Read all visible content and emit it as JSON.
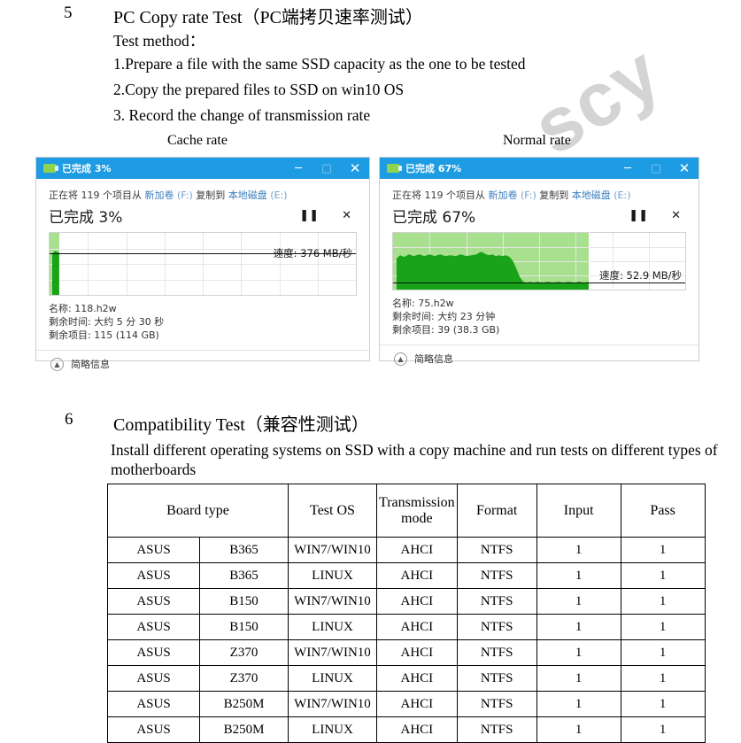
{
  "sections": [
    {
      "number": "5",
      "title": "PC Copy rate Test（PC端拷贝速率测试）",
      "lines": [
        "Test method：",
        "1.Prepare a file with the same SSD capacity as the one to be tested",
        "2.Copy the prepared files to SSD on win10 OS",
        "3. Record the change of transmission rate"
      ]
    },
    {
      "number": "6",
      "title": "Compatibility Test（兼容性测试）",
      "lines": [
        "Install different operating systems on SSD with a copy machine and run tests on different types of",
        "motherboards"
      ]
    }
  ],
  "captions": {
    "left": "Cache rate",
    "right": "Normal rate"
  },
  "watermark": {
    "text": "scy",
    "color": "#c9c9c9"
  },
  "dialogs": [
    {
      "id": "cache-rate",
      "titlebar": "已完成 3%",
      "icon": "copy-folder-icon",
      "window_buttons": {
        "minimize": "─",
        "maximize": "▢",
        "close": "✕"
      },
      "source_line": {
        "prefix": "正在将",
        "count": "119",
        "mid": "个项目从",
        "from": "新加卷",
        "from_drive": "(F:)",
        "action": "复制到",
        "to": "本地磁盘",
        "to_drive": "(E:)"
      },
      "percent_label": "已完成 3%",
      "controls": {
        "pause": "❚❚",
        "cancel": "✕"
      },
      "speed_label": "速度: 376 MB/秒",
      "progress_percent": 3,
      "meta": [
        "名称: 118.h2w",
        "剩余时间: 大约 5 分 30 秒",
        "剩余项目: 115 (114 GB)"
      ],
      "footer": "简略信息",
      "footer_icon": "chevron-up-icon"
    },
    {
      "id": "normal-rate",
      "titlebar": "已完成 67%",
      "icon": "copy-folder-icon",
      "window_buttons": {
        "minimize": "─",
        "maximize": "▢",
        "close": "✕"
      },
      "source_line": {
        "prefix": "正在将",
        "count": "119",
        "mid": "个项目从",
        "from": "新加卷",
        "from_drive": "(F:)",
        "action": "复制到",
        "to": "本地磁盘",
        "to_drive": "(E:)"
      },
      "percent_label": "已完成 67%",
      "controls": {
        "pause": "❚❚",
        "cancel": "✕"
      },
      "speed_label": "速度: 52.9 MB/秒",
      "progress_percent": 67,
      "meta": [
        "名称: 75.h2w",
        "剩余时间: 大约 23 分钟",
        "剩余项目: 39 (38.3 GB)"
      ],
      "footer": "简略信息",
      "footer_icon": "chevron-up-icon"
    }
  ],
  "compat_table": {
    "headers": [
      "Board type",
      "Test OS",
      "Transmission mode",
      "Format",
      "Input",
      "Pass"
    ],
    "rows": [
      [
        "ASUS",
        "B365",
        "WIN7/WIN10",
        "AHCI",
        "NTFS",
        "1",
        "1"
      ],
      [
        "ASUS",
        "B365",
        "LINUX",
        "AHCI",
        "NTFS",
        "1",
        "1"
      ],
      [
        "ASUS",
        "B150",
        "WIN7/WIN10",
        "AHCI",
        "NTFS",
        "1",
        "1"
      ],
      [
        "ASUS",
        "B150",
        "LINUX",
        "AHCI",
        "NTFS",
        "1",
        "1"
      ],
      [
        "ASUS",
        "Z370",
        "WIN7/WIN10",
        "AHCI",
        "NTFS",
        "1",
        "1"
      ],
      [
        "ASUS",
        "Z370",
        "LINUX",
        "AHCI",
        "NTFS",
        "1",
        "1"
      ],
      [
        "ASUS",
        "B250M",
        "WIN7/WIN10",
        "AHCI",
        "NTFS",
        "1",
        "1"
      ],
      [
        "ASUS",
        "B250M",
        "LINUX",
        "AHCI",
        "NTFS",
        "1",
        "1"
      ]
    ]
  }
}
